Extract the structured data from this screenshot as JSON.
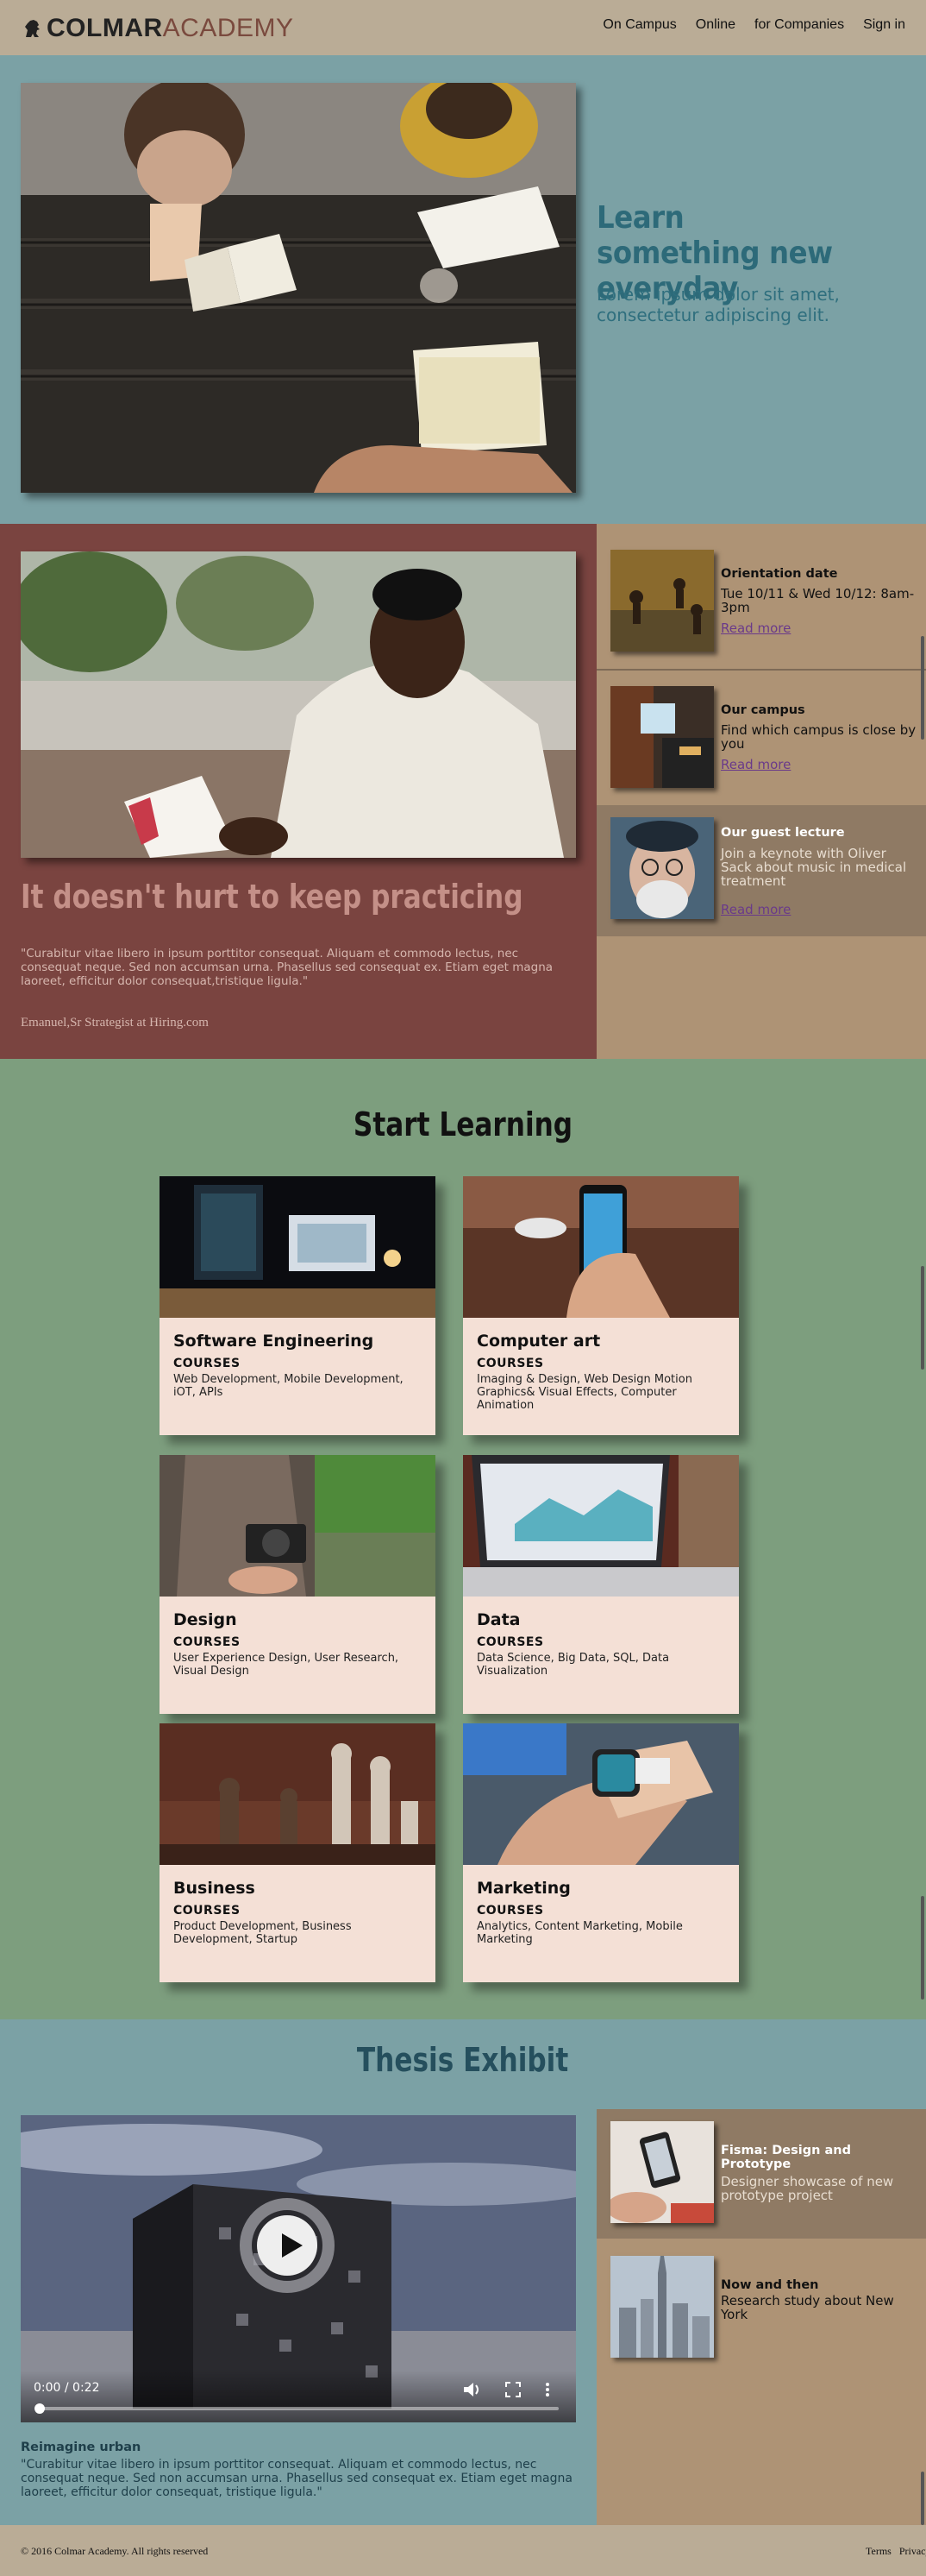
{
  "header": {
    "brand_part1": "COLMAR",
    "brand_part2": "ACADEMY",
    "nav": [
      "On Campus",
      "Online",
      "for Companies",
      "Sign in"
    ]
  },
  "hero": {
    "title": "Learn something new everyday",
    "subtitle": "Lorem ipsum dolor sit amet, consectetur adipiscing elit."
  },
  "practice": {
    "title": "It doesn't hurt to keep practicing",
    "quote": "\"Curabitur vitae libero in ipsum porttitor consequat. Aliquam et commodo lectus, nec consequat neque. Sed non accumsan urna. Phasellus sed consequat ex. Etiam eget magna laoreet, efficitur dolor consequat,tristique ligula.\"",
    "author": "Emanuel,Sr Strategist at Hiring.com"
  },
  "events": [
    {
      "title": "Orientation date",
      "text": "Tue 10/11 & Wed 10/12: 8am-3pm",
      "link": "Read more",
      "icon": "students-walking-photo"
    },
    {
      "title": "Our campus",
      "text": "Find which campus is close by you",
      "link": "Read more",
      "icon": "campus-interior-photo"
    },
    {
      "title": "Our guest lecture",
      "text": "Join a keynote with Oliver Sack about music in medical treatment",
      "link": "Read more",
      "icon": "lecturer-portrait-photo"
    }
  ],
  "learning": {
    "title": "Start Learning",
    "courses_label": "COURSES",
    "cards": [
      {
        "title": "Software Engineering",
        "desc": "Web Development, Mobile Development, iOT, APIs"
      },
      {
        "title": "Computer art",
        "desc": "Imaging & Design, Web Design Motion Graphics& Visual Effects, Computer Animation"
      },
      {
        "title": "Design",
        "desc": "User Experience Design, User Research, Visual Design"
      },
      {
        "title": "Data",
        "desc": "Data Science, Big Data, SQL, Data Visualization"
      },
      {
        "title": "Business",
        "desc": "Product Development, Business Development, Startup"
      },
      {
        "title": "Marketing",
        "desc": "Analytics, Content Marketing, Mobile Marketing"
      }
    ]
  },
  "thesis": {
    "title": "Thesis Exhibit",
    "video_time": "0:00 / 0:22",
    "video_progress": 0,
    "caption": "Reimagine urban",
    "quote": "\"Curabitur vitae libero in ipsum porttitor consequat. Aliquam et commodo lectus, nec consequat neque. Sed non accumsan urna. Phasellus sed consequat ex. Etiam eget magna laoreet, efficitur dolor consequat, tristique ligula.\"",
    "items": [
      {
        "title": "Fisma: Design and Prototype",
        "text": "Designer showcase of new prototype project"
      },
      {
        "title": "Now and then",
        "text": "Research study about New York"
      }
    ]
  },
  "footer": {
    "copyright": "© 2016 Colmar Academy. All rights reserved",
    "links": [
      "Terms",
      "Privacy"
    ]
  },
  "colors": {
    "header_bg": "#baac96",
    "hero_bg": "#7ba1a5",
    "practice_bg": "#7a4440",
    "side_bg": "#ae9375",
    "learning_bg": "#7d9e7e",
    "card_bg": "#f4e0d6"
  }
}
